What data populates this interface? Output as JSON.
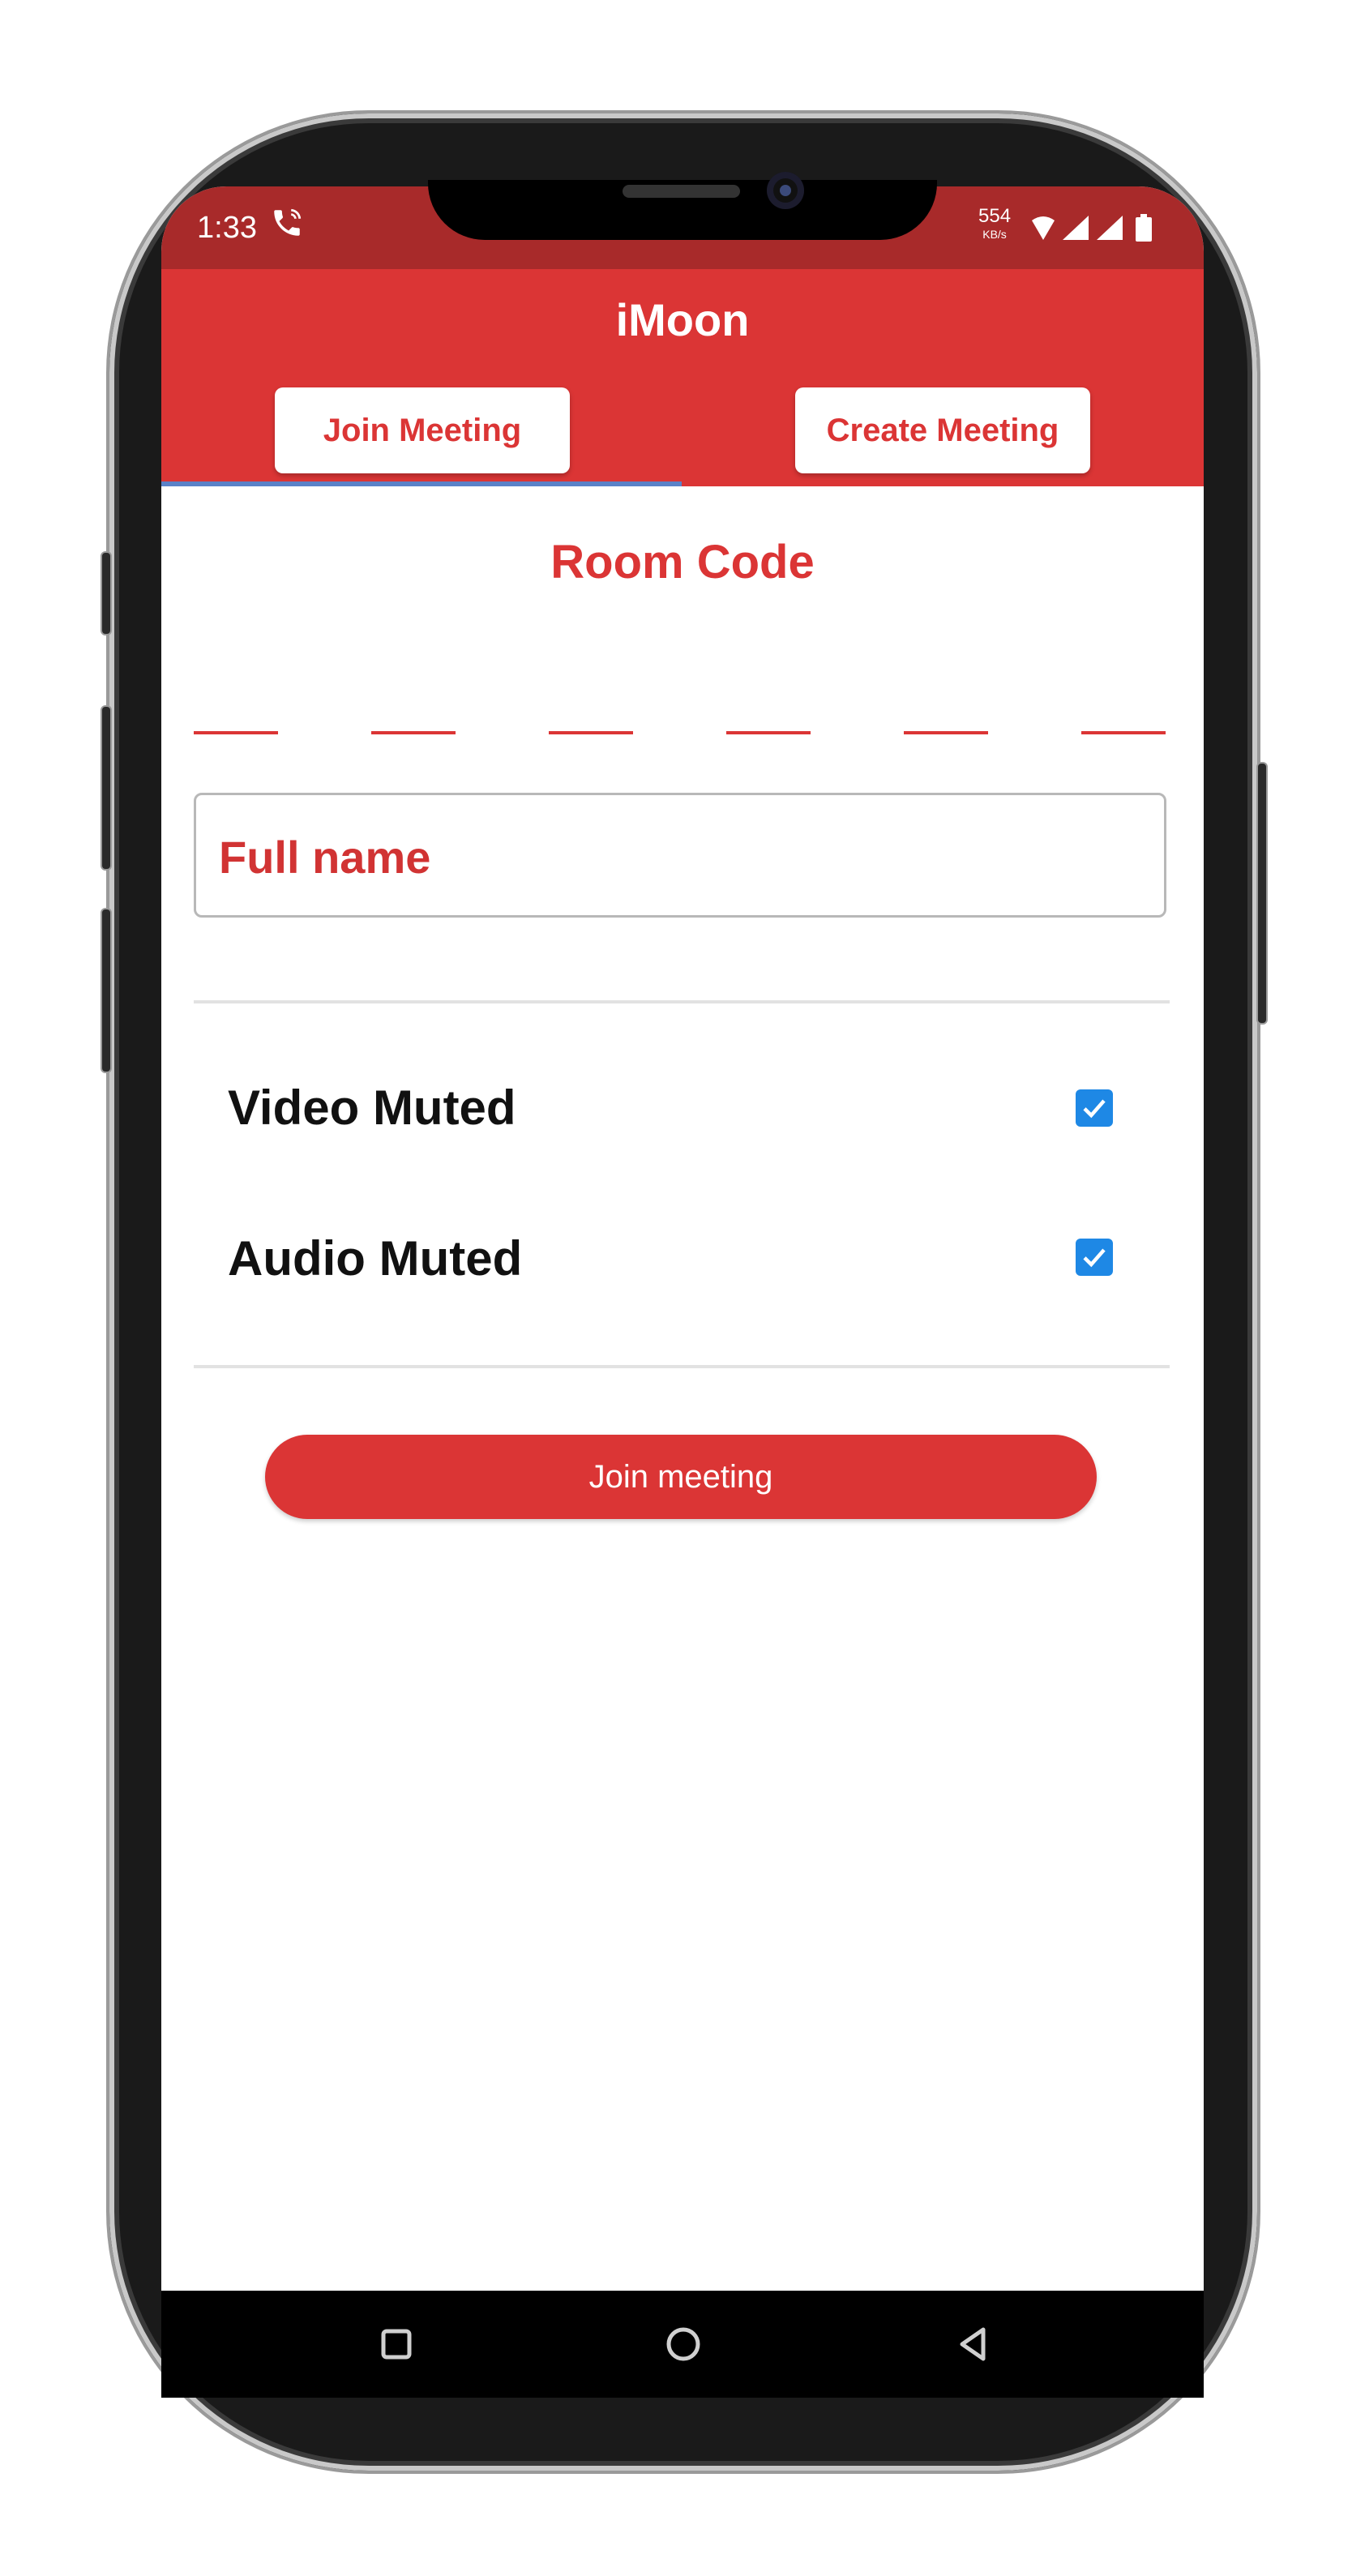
{
  "status_bar": {
    "time": "1:33",
    "speed_value": "554",
    "speed_unit": "KB/s",
    "icons": [
      "phone-call-icon",
      "wifi-icon",
      "signal-icon",
      "signal-icon",
      "battery-icon"
    ]
  },
  "app": {
    "title": "iMoon",
    "tabs": [
      {
        "label": "Join Meeting",
        "selected": true
      },
      {
        "label": "Create Meeting",
        "selected": false
      }
    ],
    "accent_color": "#db3535",
    "indicator_color": "#5a82c8"
  },
  "form": {
    "room_code_title": "Room Code",
    "code_digits": [
      "",
      "",
      "",
      "",
      "",
      ""
    ],
    "name_placeholder": "Full name",
    "options": [
      {
        "label": "Video Muted",
        "checked": true
      },
      {
        "label": "Audio Muted",
        "checked": true
      }
    ],
    "submit_label": "Join meeting"
  },
  "nav": {
    "icons": [
      "recents-square-icon",
      "home-circle-icon",
      "back-triangle-icon"
    ]
  }
}
